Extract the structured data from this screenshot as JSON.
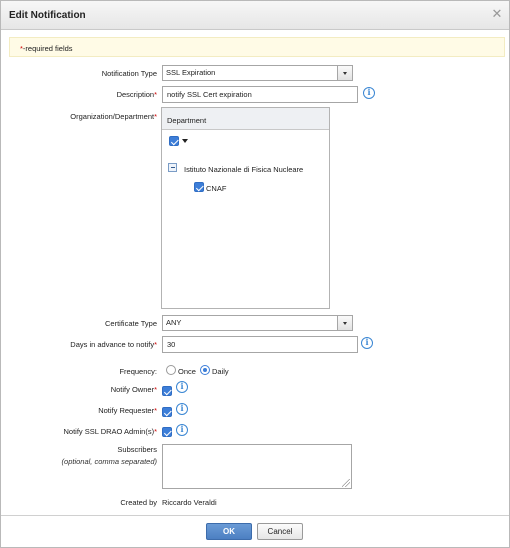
{
  "dialog": {
    "title": "Edit Notification",
    "close_icon": "close-icon",
    "required_note_star": "*",
    "required_note_text": "-required fields"
  },
  "form": {
    "notification_type": {
      "label": "Notification Type",
      "value": "SSL Expiration"
    },
    "description": {
      "label": "Description",
      "required_mark": "*",
      "value": "notify SSL Cert expiration"
    },
    "organization": {
      "label": "Organization/Department",
      "required_mark": "*",
      "tree_header": "Department",
      "org_name": "Istituto Nazionale di Fisica Nucleare",
      "dept_name": "CNAF"
    },
    "certificate_type": {
      "label": "Certificate Type",
      "value": "ANY"
    },
    "days_in_advance": {
      "label": "Days in advance to notify",
      "required_mark": "*",
      "value": "30"
    },
    "frequency": {
      "label": "Frequency:",
      "options": [
        "Once",
        "Daily"
      ],
      "selected": "Daily"
    },
    "notify_owner": {
      "label": "Notify Owner",
      "required_mark": "*",
      "checked": true
    },
    "notify_requester": {
      "label": "Notify Requester",
      "required_mark": "*",
      "checked": true
    },
    "notify_admins": {
      "label": "Notify SSL DRAO Admin(s)",
      "required_mark": "*",
      "checked": true
    },
    "subscribers": {
      "label": "Subscribers",
      "hint": "(optional, comma separated)",
      "value": ""
    },
    "created_by": {
      "label": "Created by",
      "value": "Riccardo Veraldi"
    }
  },
  "buttons": {
    "ok": "OK",
    "cancel": "Cancel"
  },
  "colors": {
    "accent": "#3d7ed8",
    "required": "#cc0000",
    "banner": "#fffbe6"
  }
}
